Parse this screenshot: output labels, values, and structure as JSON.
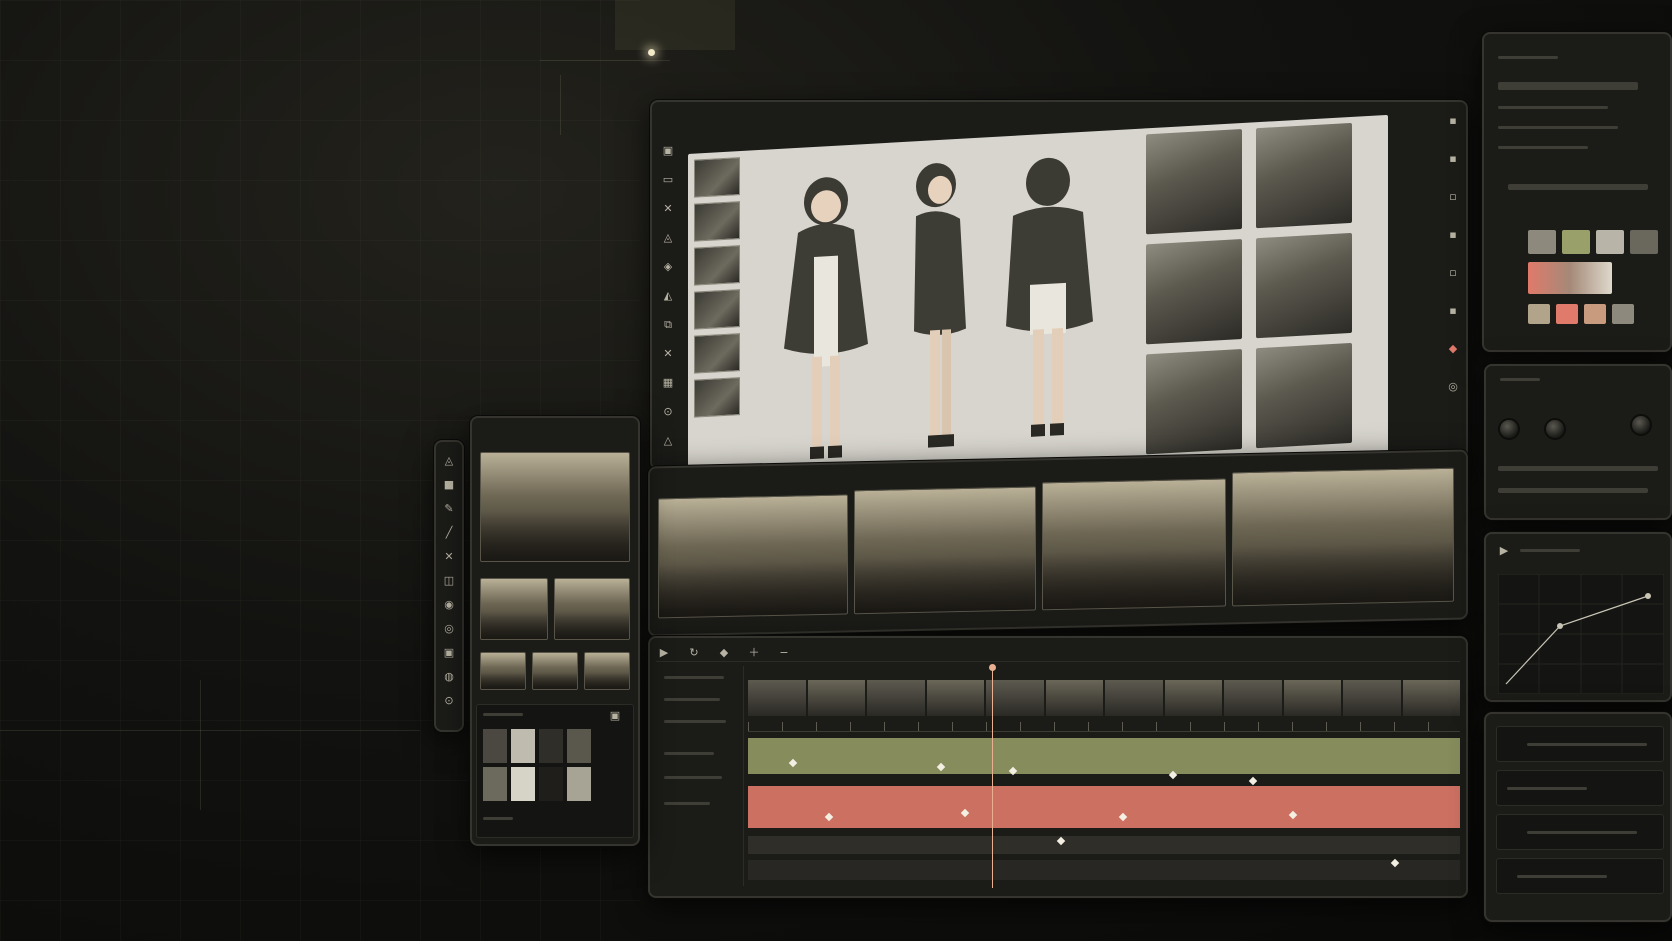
{
  "palette": {
    "accent_green": "#9aa06a",
    "accent_salmon": "#e07a6a",
    "playhead": "#e8b090",
    "sheet": "#d7d5cd"
  },
  "icons": {
    "main_toolbar": [
      "layers-icon",
      "frame-icon",
      "brush-icon",
      "shapes-icon",
      "transform-icon",
      "mask-icon",
      "layers-stack-icon",
      "crop-icon",
      "grid-icon",
      "settings-icon",
      "warning-icon"
    ],
    "mobile_toolbar": [
      "layers-icon",
      "square-icon",
      "pen-icon",
      "line-icon",
      "transform-icon",
      "mask-icon",
      "stamp-icon",
      "circle-icon",
      "grid-icon",
      "dial-icon",
      "settings-icon"
    ],
    "right_tools": [
      "zoom-icon",
      "hand-icon",
      "eyedrop-icon",
      "fill-icon",
      "text-icon",
      "gradient-icon",
      "marker-icon",
      "target-icon"
    ]
  },
  "character_sheet": {
    "detail_crops": 6,
    "turnaround_views": [
      "front",
      "side",
      "back"
    ],
    "expressions": 6
  },
  "storyboard": {
    "frames": 4
  },
  "timeline": {
    "tracks": 6,
    "filmstrip_frames": 12
  }
}
